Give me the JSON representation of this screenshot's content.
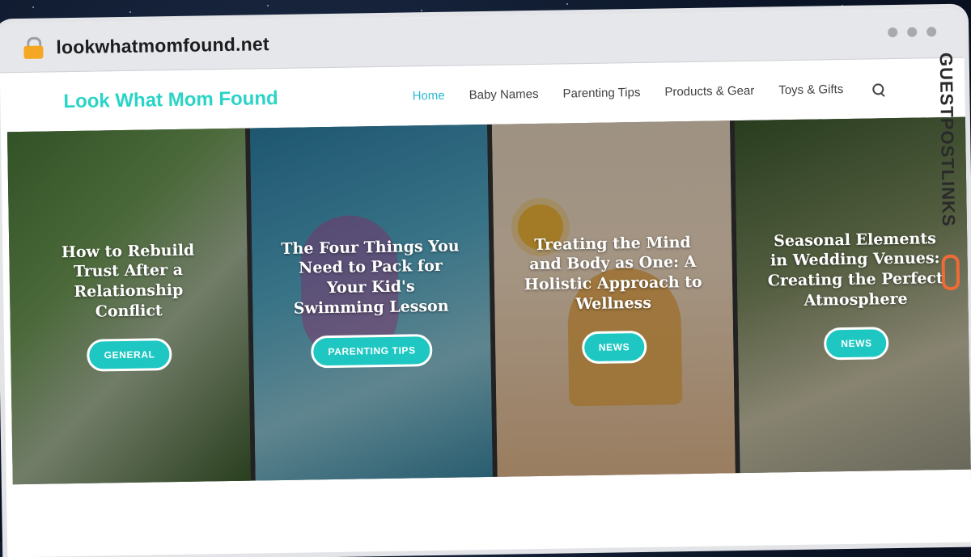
{
  "browser": {
    "url": "lookwhatmomfound.net"
  },
  "site": {
    "logo": "Look What Mom Found",
    "nav": [
      {
        "label": "Home",
        "active": true
      },
      {
        "label": "Baby Names",
        "active": false
      },
      {
        "label": "Parenting Tips",
        "active": false
      },
      {
        "label": "Products & Gear",
        "active": false
      },
      {
        "label": "Toys & Gifts",
        "active": false
      }
    ],
    "search_icon": "search-icon"
  },
  "cards": [
    {
      "title": "How to Rebuild Trust After a Relationship Conflict",
      "category": "GENERAL"
    },
    {
      "title": "The Four Things You Need to Pack for Your Kid's Swimming Lesson",
      "category": "PARENTING TIPS"
    },
    {
      "title": "Treating the Mind and Body as One: A Holistic Approach to Wellness",
      "category": "NEWS"
    },
    {
      "title": "Seasonal Elements in Wedding Venues: Creating the Perfect Atmosphere",
      "category": "NEWS"
    }
  ],
  "side_brand": {
    "text": "GUESTPOSTLINKS"
  },
  "colors": {
    "accent": "#2ad4c6",
    "nav_active": "#2ab8d3",
    "badge": "#1fc7c2",
    "lock": "#f5a623",
    "brand_chain": "#f06a35"
  }
}
